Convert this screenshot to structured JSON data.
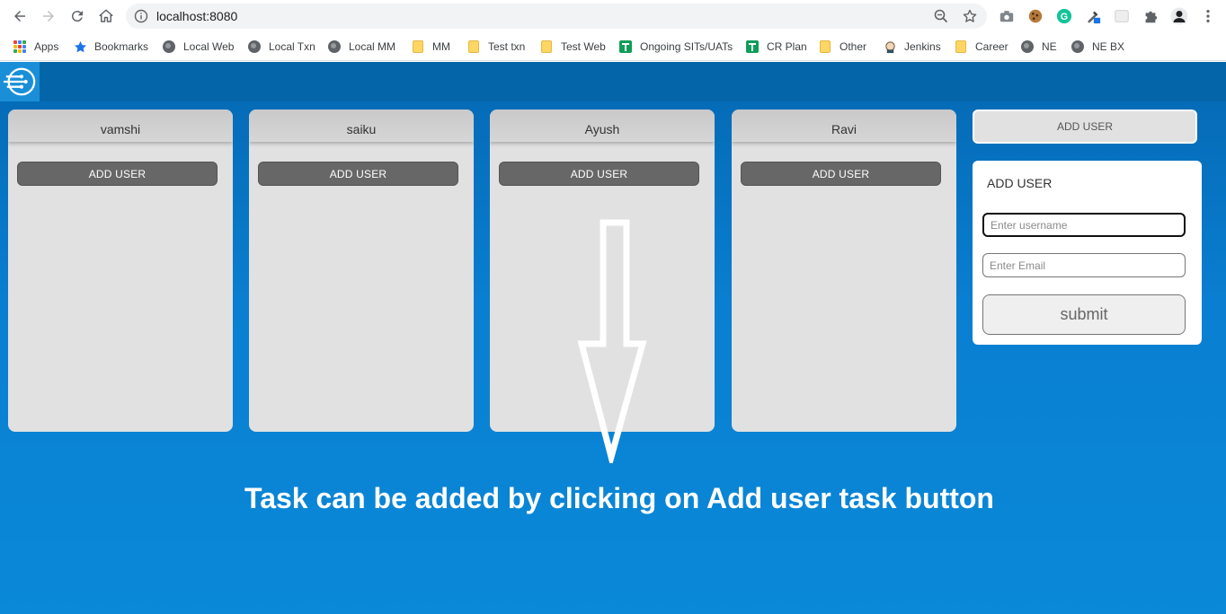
{
  "browser": {
    "url": "localhost:8080",
    "bookmarks": [
      {
        "label": "Apps",
        "icon": "apps-grid-icon"
      },
      {
        "label": "Bookmarks",
        "icon": "star-icon"
      },
      {
        "label": "Local Web",
        "icon": "globe-icon"
      },
      {
        "label": "Local Txn",
        "icon": "globe-icon"
      },
      {
        "label": "Local MM",
        "icon": "globe-icon"
      },
      {
        "label": "MM",
        "icon": "folder-icon"
      },
      {
        "label": "Test txn",
        "icon": "folder-icon"
      },
      {
        "label": "Test Web",
        "icon": "folder-icon"
      },
      {
        "label": "Ongoing SITs/UATs",
        "icon": "sheet-icon"
      },
      {
        "label": "CR Plan",
        "icon": "sheet-icon"
      },
      {
        "label": "Other",
        "icon": "folder-icon"
      },
      {
        "label": "Jenkins",
        "icon": "jenkins-icon"
      },
      {
        "label": "Career",
        "icon": "folder-icon"
      },
      {
        "label": "NE",
        "icon": "globe-icon"
      },
      {
        "label": "NE BX",
        "icon": "globe-icon"
      }
    ]
  },
  "app": {
    "columns": [
      {
        "name": "vamshi",
        "button": "ADD USER"
      },
      {
        "name": "saiku",
        "button": "ADD USER"
      },
      {
        "name": "Ayush",
        "button": "ADD USER"
      },
      {
        "name": "Ravi",
        "button": "ADD USER"
      }
    ],
    "top_add_button": "ADD USER",
    "form": {
      "title": "ADD USER",
      "username_placeholder": "Enter username",
      "email_placeholder": "Enter Email",
      "submit_label": "submit"
    },
    "caption": "Task can be added by clicking on Add user task button"
  },
  "colors": {
    "header": "#0466a8",
    "background": "#0a7fd1",
    "column": "#e1e1e1",
    "column_button": "#676767"
  }
}
